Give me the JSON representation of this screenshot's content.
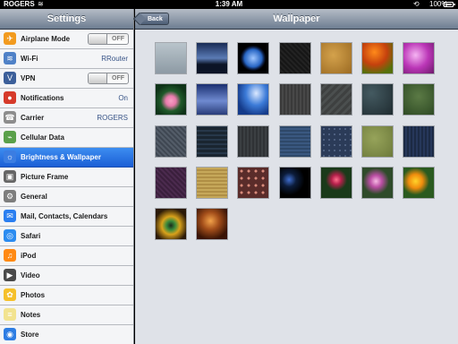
{
  "status_bar": {
    "carrier": "ROGERS",
    "wifi_icon": "wifi-icon",
    "time": "1:39 AM",
    "lock_icon": "rotation-lock-icon",
    "battery": "100%",
    "battery_level": 1.0
  },
  "sidebar": {
    "title": "Settings",
    "items": [
      {
        "label": "Airplane Mode",
        "icon": "airplane-icon",
        "toggle": "OFF",
        "icon_color": "#f29b1f"
      },
      {
        "label": "Wi-Fi",
        "icon": "wifi-icon",
        "value": "RRouter",
        "icon_color": "#4f81c7"
      },
      {
        "label": "VPN",
        "icon": "vpn-icon",
        "toggle": "OFF",
        "icon_color": "#3c5f9a"
      },
      {
        "label": "Notifications",
        "icon": "notifications-icon",
        "value": "On",
        "icon_color": "#d63a2a"
      },
      {
        "label": "Carrier",
        "icon": "carrier-icon",
        "value": "ROGERS",
        "icon_color": "#8d8d8d"
      },
      {
        "label": "Cellular Data",
        "icon": "cellular-data-icon",
        "icon_color": "#5aa04a"
      },
      {
        "label": "Brightness & Wallpaper",
        "icon": "brightness-icon",
        "icon_color": "#3b7de2",
        "active": true
      },
      {
        "label": "Picture Frame",
        "icon": "picture-frame-icon",
        "icon_color": "#666666"
      },
      {
        "label": "General",
        "icon": "gear-icon",
        "icon_color": "#7d7d7d"
      },
      {
        "label": "Mail, Contacts, Calendars",
        "icon": "mail-icon",
        "icon_color": "#2a7ef0"
      },
      {
        "label": "Safari",
        "icon": "safari-icon",
        "icon_color": "#2c8cf0"
      },
      {
        "label": "iPod",
        "icon": "ipod-icon",
        "icon_color": "#ff8a14"
      },
      {
        "label": "Video",
        "icon": "video-icon",
        "icon_color": "#4a4a4a"
      },
      {
        "label": "Photos",
        "icon": "photos-icon",
        "icon_color": "#f5c02a"
      },
      {
        "label": "Notes",
        "icon": "notes-icon",
        "icon_color": "#f2e38f"
      },
      {
        "label": "Store",
        "icon": "store-icon",
        "icon_color": "#2d7de3"
      }
    ]
  },
  "main": {
    "back_label": "Back",
    "title": "Wallpaper",
    "wallpapers": [
      "wallpaper-1",
      "wallpaper-2",
      "wallpaper-3",
      "wallpaper-4",
      "wallpaper-5",
      "wallpaper-6",
      "wallpaper-7",
      "wallpaper-8",
      "wallpaper-9",
      "wallpaper-10",
      "wallpaper-11",
      "wallpaper-12",
      "wallpaper-13",
      "wallpaper-14",
      "wallpaper-15",
      "wallpaper-16",
      "wallpaper-17",
      "wallpaper-18",
      "wallpaper-19",
      "wallpaper-20",
      "wallpaper-21",
      "wallpaper-22",
      "wallpaper-23",
      "wallpaper-24",
      "wallpaper-25",
      "wallpaper-26",
      "wallpaper-27",
      "wallpaper-28",
      "wallpaper-29",
      "wallpaper-30"
    ]
  }
}
